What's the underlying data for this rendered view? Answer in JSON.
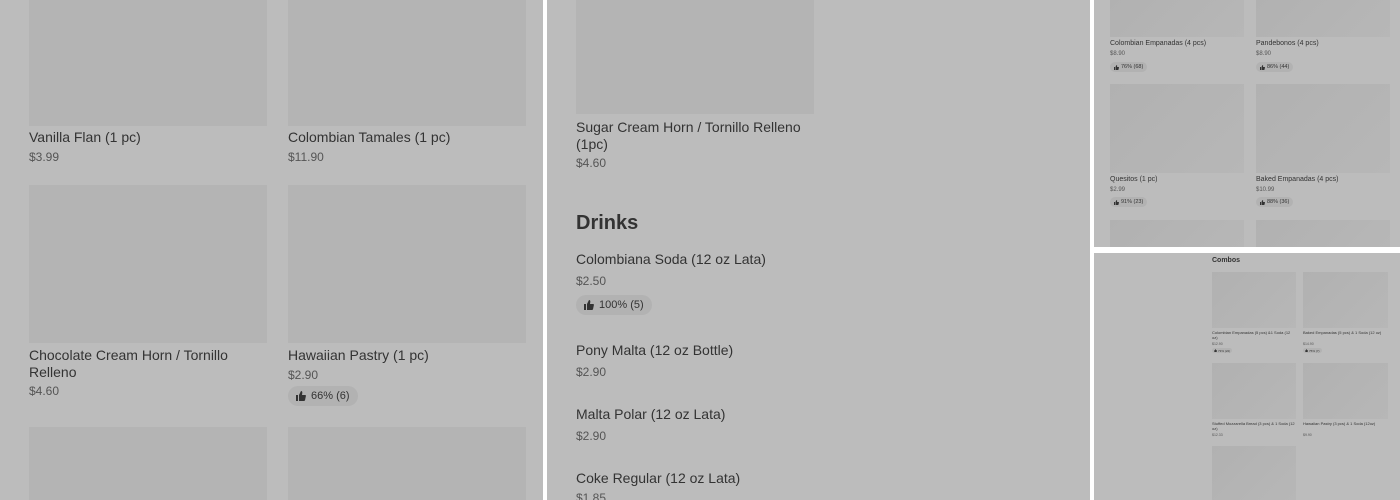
{
  "left_panel": {
    "items": [
      {
        "name": "Vanilla Flan (1 pc)",
        "price": "$3.99"
      },
      {
        "name": "Colombian Tamales (1 pc)",
        "price": "$11.90"
      },
      {
        "name": "Chocolate Cream Horn / Tornillo Relleno",
        "price": "$4.60"
      },
      {
        "name": "Hawaiian Pastry (1 pc)",
        "price": "$2.90",
        "rating": "66% (6)"
      }
    ]
  },
  "middle_panel": {
    "top_item": {
      "name": "Sugar Cream Horn / Tornillo Relleno (1pc)",
      "price": "$4.60"
    },
    "section_title": "Drinks",
    "items": [
      {
        "name": "Colombiana Soda (12 oz Lata)",
        "price": "$2.50",
        "rating": "100% (5)"
      },
      {
        "name": "Pony Malta (12 oz Bottle)",
        "price": "$2.90"
      },
      {
        "name": "Malta Polar (12 oz Lata)",
        "price": "$2.90"
      },
      {
        "name": "Coke Regular (12 oz Lata)",
        "price": "$1.85"
      }
    ]
  },
  "top_right_panel": {
    "items": [
      {
        "name": "Colombian Empanadas (4 pcs)",
        "price": "$8.90",
        "rating": "76% (68)"
      },
      {
        "name": "Pandebonos (4 pcs)",
        "price": "$8.90",
        "rating": "86% (44)"
      },
      {
        "name": "Quesitos (1 pc)",
        "price": "$2.99",
        "rating": "91% (23)"
      },
      {
        "name": "Baked Empanadas (4 pcs)",
        "price": "$10.99",
        "rating": "88% (36)"
      }
    ]
  },
  "bottom_right_panel": {
    "section_title": "Combos",
    "items": [
      {
        "name": "Colombian Empanadas (5 pcs) &1 Soda (12 oz)",
        "price": "$12.90",
        "rating": "73% (22)"
      },
      {
        "name": "Baked Empanadas (5 pcs) & 1 Soda (12 oz)",
        "price": "$14.90",
        "rating": "75% (7)"
      },
      {
        "name": "Stuffed Mozzarella Bread (3 pcs) & 1 Soda (12 oz)",
        "price": "$12.33"
      },
      {
        "name": "Hawaiian Pastry (3 pcs) & 1 Soda (12oz)",
        "price": "$9.90"
      }
    ]
  },
  "icons": {
    "rating": "thumbs-up-icon"
  },
  "colors": {
    "overlay": "#bcbcbc",
    "thumbnail": "#b4b4b4",
    "text": "#333333"
  }
}
